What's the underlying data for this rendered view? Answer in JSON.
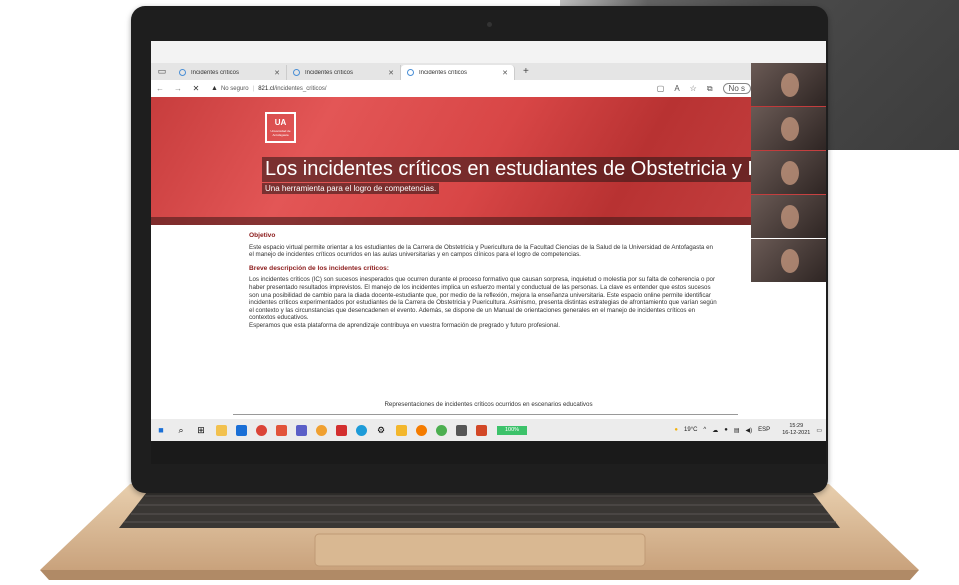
{
  "browser": {
    "tabs": [
      {
        "title": "Incidentes críticos",
        "active": false
      },
      {
        "title": "Incidentes críticos",
        "active": false
      },
      {
        "title": "Incidentes críticos",
        "active": true
      }
    ],
    "security_label": "No seguro",
    "url_host": "821.cl",
    "url_path": "/incidentes_criticos/",
    "profile_chip": "No s"
  },
  "hero": {
    "logo_text": "UA",
    "logo_sub": "Universidad de Antofagasta",
    "title": "Los incidentes críticos en estudiantes de Obstetricia y Puericultura",
    "subtitle": "Una herramienta para el logro de competencias."
  },
  "content": {
    "objective_heading": "Objetivo",
    "objective_text": "Este espacio virtual permite orientar a los estudiantes de la Carrera de Obstetricia y Puericultura de la Facultad Ciencias de la Salud de la Universidad de Antofagasta en el manejo de incidentes críticos ocurridos en las aulas universitarias y en campos clínicos para el logro de competencias.",
    "brief_heading": "Breve descripción de los incidentes críticos:",
    "brief_text": "Los incidentes críticos (IC) son sucesos inesperados que ocurren durante el proceso formativo que causan sorpresa, inquietud o molestia por su falta de coherencia o por haber presentado resultados imprevistos. El manejo de los incidentes implica un esfuerzo mental y conductual de las personas. La clave es entender que estos sucesos son una posibilidad de cambio para la diada docente-estudiante que, por medio de la reflexión, mejora la enseñanza universitaria. Este espacio online permite identificar incidentes críticos experimentados por estudiantes de la Carrera de Obstetricia y Puericultura. Asimismo, presenta distintas estrategias de afrontamiento que varían según el contexto y las circunstancias que desencadenen el evento. Además, se dispone de un Manual de orientaciones generales en el manejo de incidentes críticos en contextos educativos.",
    "closing_text": "Esperamos que esta plataforma de aprendizaje contribuya en vuestra formación de pregrado y futuro profesional.",
    "representations_title": "Representaciones de incidentes críticos ocurridos en escenarios educativos"
  },
  "taskbar": {
    "progress_label": "100%",
    "progress_value": 100,
    "weather": "19°C",
    "language": "ESP",
    "time": "15:29",
    "date": "16-12-2021"
  },
  "colors": {
    "hero_red": "#d84646",
    "heading_red": "#8b1a1a",
    "progress_green": "#3cc26a"
  }
}
